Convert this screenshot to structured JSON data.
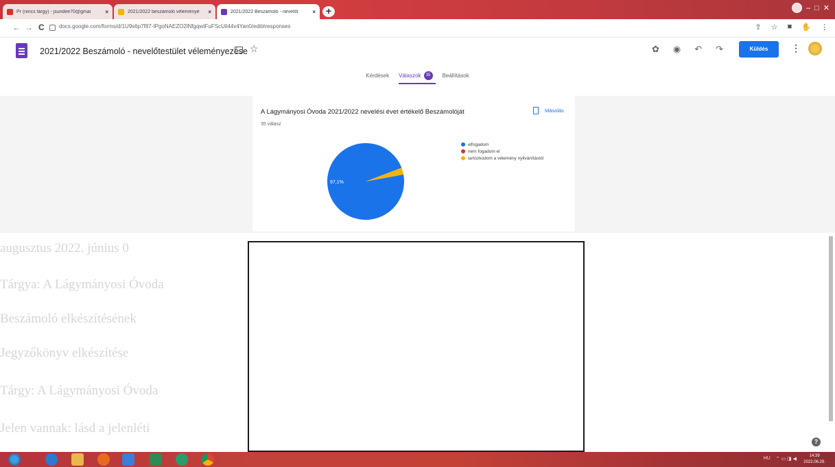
{
  "browser": {
    "tabs": [
      {
        "title": "Pr (nincs tárgy) - jsundee70@gmai",
        "active": false,
        "icon": "gmail-icon",
        "color": "#d93025"
      },
      {
        "title": "2021/2022 beszámoló véleményé",
        "active": false,
        "icon": "drive-icon",
        "color": "#f4b400"
      },
      {
        "title": "2021/2022 Beszámoló - nevelőt",
        "active": true,
        "icon": "forms-icon",
        "color": "#673ab7"
      }
    ],
    "new_tab": "+",
    "url": "docs.google.com/forms/d/1U9s6p7f87-IPgoNAEZO2lNfgqwtFuFScUil44v4Yan0/edit#responses"
  },
  "form": {
    "title": "2021/2022 Beszámoló - nevelőtestület véleményezése",
    "send_label": "Küldés",
    "tabs": [
      {
        "label": "Kérdések",
        "active": false
      },
      {
        "label": "Válaszok",
        "active": true,
        "badge": "35"
      },
      {
        "label": "Beállítások",
        "active": false
      }
    ]
  },
  "question": {
    "title": "A Lágymányosi Óvoda 2021/2022 nevelési évet értékelő Beszámolóját",
    "response_count": "35 válasz",
    "copy_label": "Másolás"
  },
  "chart_data": {
    "type": "pie",
    "categories": [
      "elfogadom",
      "nem fogadom el",
      "tartózkodom a vélemény nyilvánítástól"
    ],
    "values": [
      97.1,
      0,
      2.9
    ],
    "colors": [
      "#1a73e8",
      "#d93025",
      "#f4b400"
    ],
    "data_labels": [
      "97,1%"
    ],
    "legend": "right"
  },
  "background_doc": {
    "lines": [
      "augusztus 2022. június 0",
      "Tárgya: A Lágymányosi Óvoda",
      "Beszámoló elkészítésének",
      "Jegyzőkönyv elkészítése",
      "Tárgy: A Lágymányosi Óvoda",
      "Jelen vannak: lásd a jelenléti"
    ]
  },
  "taskbar": {
    "lang": "HU",
    "time": "14:39",
    "date": "2022.06.29."
  }
}
